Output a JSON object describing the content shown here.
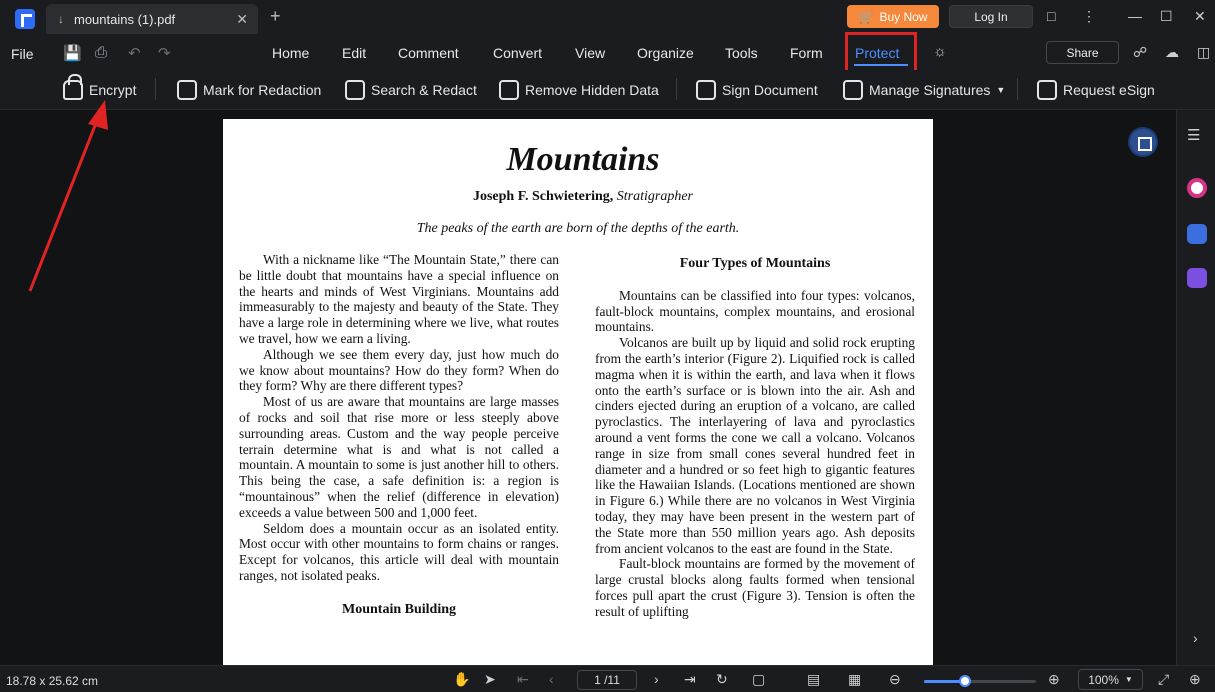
{
  "titlebar": {
    "tab_title": "mountains (1).pdf",
    "buy_now": "Buy Now",
    "login": "Log In"
  },
  "menubar": {
    "file": "File",
    "items": [
      "Home",
      "Edit",
      "Comment",
      "Convert",
      "View",
      "Organize",
      "Tools",
      "Form",
      "Protect"
    ],
    "active": "Protect",
    "share": "Share"
  },
  "toolbar": {
    "encrypt": "Encrypt",
    "mark_redaction": "Mark for Redaction",
    "search_redact": "Search & Redact",
    "remove_hidden": "Remove Hidden Data",
    "sign_document": "Sign Document",
    "manage_signatures": "Manage Signatures",
    "request_esign": "Request eSign"
  },
  "document": {
    "title": "Mountains",
    "author_name": "Joseph F. Schwietering,",
    "author_role": "Stratigrapher",
    "epigraph": "The peaks of the earth are born of the depths of the earth.",
    "left_paragraphs": [
      "With a nickname like “The Mountain State,” there can be little doubt that mountains have a special influence on the hearts and minds of West Virginians. Mountains add immeasurably to the majesty and beauty of the State. They have a large role in determining where we live, what routes we travel, how we earn a living.",
      "Although we see them every day, just how much do we know about mountains? How do they form? When do they form? Why are there different types?",
      "Most of us are aware that mountains are large masses of rocks and soil that rise more or less steeply above surrounding areas. Custom and the way people perceive terrain determine what is and what is not called a mountain. A mountain to some is just another hill to others. This being the case, a safe definition is: a region is “mountainous” when the relief (difference in elevation) exceeds a value between 500 and 1,000 feet.",
      "Seldom does a mountain occur as an isolated entity. Most occur with other mountains to form chains or ranges. Except for volcanos, this article will deal with mountain ranges, not isolated peaks."
    ],
    "left_heading": "Mountain Building",
    "right_heading": "Four Types of Mountains",
    "right_paragraphs": [
      "Mountains can be classified into four types: volcanos, fault-block mountains, complex mountains, and erosional mountains.",
      "Volcanos are built up by liquid and solid rock erupting from the earth’s interior (Figure 2). Liquified rock is called magma when it is within the earth, and lava when it flows onto the earth’s surface or is blown into the air. Ash and cinders ejected during an eruption of a volcano, are called pyroclastics. The interlayering of lava and pyroclastics around a vent forms the cone we call a volcano. Volcanos range in size from small cones several hundred feet in diameter and a hundred or so feet high to gigantic features like the Hawaiian Islands. (Locations mentioned are shown in Figure 6.) While there are no volcanos in West Virginia today, they may have been present in the western part of the State more than 550 million years ago. Ash deposits from ancient volcanos to the east are found in the State.",
      "Fault-block mountains are formed by the movement of large crustal blocks along faults formed when tensional forces pull apart the crust (Figure 3). Tension is often the result of uplifting"
    ]
  },
  "statusbar": {
    "dimensions": "18.78 x 25.62 cm",
    "page": "1 /11",
    "zoom": "100%",
    "zoom_fraction": 0.37
  },
  "colors": {
    "accent": "#4d8dff",
    "buy_now": "#f5883b",
    "highlight_box": "#e02424",
    "arrow": "#e02424"
  }
}
